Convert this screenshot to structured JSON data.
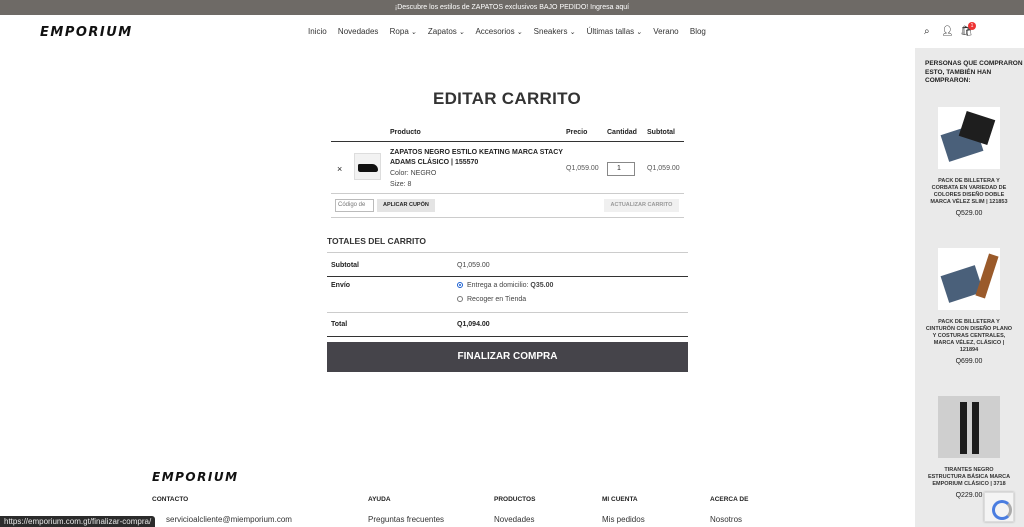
{
  "announcement": "¡Descubre los estilos de ZAPATOS exclusivos BAJO PEDIDO! Ingresa aquí",
  "brand": "EMPORIUM",
  "nav": [
    "Inicio",
    "Novedades",
    "Ropa",
    "Zapatos",
    "Accesorios",
    "Sneakers",
    "Últimas tallas",
    "Verano",
    "Blog"
  ],
  "cart_count": "1",
  "page_title": "EDITAR CARRITO",
  "cart": {
    "headers": {
      "product": "Producto",
      "price": "Precio",
      "quantity": "Cantidad",
      "subtotal": "Subtotal"
    },
    "item": {
      "remove": "×",
      "name": "ZAPATOS NEGRO ESTILO KEATING MARCA STACY ADAMS CLÁSICO | 155570",
      "color": "Color: NEGRO",
      "size": "Size: 8",
      "price": "Q1,059.00",
      "quantity": "1",
      "subtotal": "Q1,059.00"
    },
    "coupon_placeholder": "Código de cupón",
    "apply_coupon": "APLICAR CUPÓN",
    "update_cart": "ACTUALIZAR CARRITO"
  },
  "totals": {
    "title": "TOTALES DEL CARRITO",
    "subtotal_label": "Subtotal",
    "subtotal_value": "Q1,059.00",
    "shipping_label": "Envío",
    "shipping_option_1": "Entrega a domicilio: ",
    "shipping_option_1_price": "Q35.00",
    "shipping_option_2": "Recoger en Tienda",
    "total_label": "Total",
    "total_value": "Q1,094.00"
  },
  "checkout": "FINALIZAR COMPRA",
  "footer": {
    "columns": [
      "CONTACTO",
      "AYUDA",
      "PRODUCTOS",
      "MI CUENTA",
      "ACERCA DE"
    ],
    "links": [
      "servicioalcliente@miemporium.com",
      "Preguntas frecuentes",
      "Novedades",
      "Mis pedidos",
      "Nosotros"
    ]
  },
  "status_url": "https://emporium.com.gt/finalizar-compra/",
  "sidebar": {
    "title": "PERSONAS QUE COMPRARON ESTO, TAMBIÉN HAN COMPRARON:",
    "products": [
      {
        "name": "PACK DE BILLETERA Y CORBATA EN VARIEDAD DE COLORES DISEÑO DOBLE MARCA VÉLEZ SLIM | 121853",
        "price": "Q529.00"
      },
      {
        "name": "PACK DE BILLETERA Y CINTURÓN CON DISEÑO PLANO Y COSTURAS CENTRALES, MARCA VÉLEZ, CLÁSICO | 121894",
        "price": "Q699.00"
      },
      {
        "name": "TIRANTES NEGRO ESTRUCTURA BÁSICA MARCA EMPORIUM CLÁSICO | 3718",
        "price": "Q229.00"
      }
    ]
  }
}
